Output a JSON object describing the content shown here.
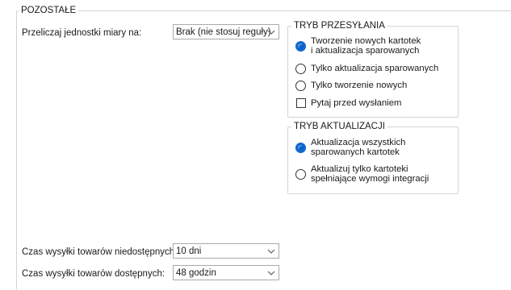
{
  "section": {
    "title": "POZOSTAŁE"
  },
  "units": {
    "label": "Przeliczaj jednostki miary na:",
    "value": "Brak (nie stosuj reguły)"
  },
  "transfer_mode": {
    "title": "TRYB PRZESYŁANIA",
    "options": [
      {
        "line1": "Tworzenie nowych kartotek",
        "line2": "i aktualizacja sparowanych",
        "checked": true
      },
      {
        "line1": "Tylko aktualizacja sparowanych",
        "checked": false
      },
      {
        "line1": "Tylko tworzenie nowych",
        "checked": false
      }
    ],
    "ask_before_send": {
      "label": "Pytaj przed wysłaniem",
      "checked": false
    }
  },
  "update_mode": {
    "title": "TRYB AKTUALIZACJI",
    "options": [
      {
        "line1": "Aktualizacja wszystkich",
        "line2": "sparowanych kartotek",
        "checked": true
      },
      {
        "line1": "Aktualizuj tylko kartoteki",
        "line2": "spełniające wymogi integracji",
        "checked": false
      }
    ]
  },
  "shipping_unavailable": {
    "label": "Czas wysyłki towarów niedostępnych:",
    "value": "10 dni"
  },
  "shipping_available": {
    "label": "Czas wysyłki towarów dostępnych:",
    "value": "48 godzin"
  },
  "colors": {
    "accent": "#0a63c9",
    "border": "#d4d4d4"
  }
}
